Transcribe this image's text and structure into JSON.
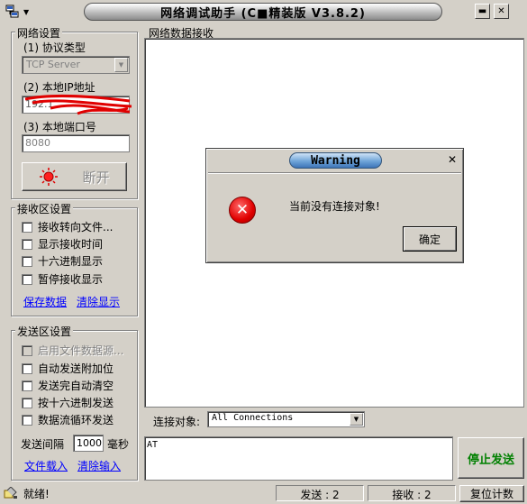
{
  "window": {
    "title": "网络调试助手 (C■精装版 V3.8.2)",
    "min_glyph": "▬",
    "close_glyph": "✕",
    "menu_arrow": "▼"
  },
  "net_settings": {
    "title": "网络设置",
    "protocol_label": "(1) 协议类型",
    "protocol_value": "TCP Server",
    "ip_label": "(2) 本地IP地址",
    "ip_value": "192.1",
    "port_label": "(3) 本地端口号",
    "port_value": "8080",
    "disconnect_label": "断开"
  },
  "recv_settings": {
    "title": "接收区设置",
    "options": [
      "接收转向文件...",
      "显示接收时间",
      "十六进制显示",
      "暂停接收显示"
    ],
    "save_link": "保存数据",
    "clear_link": "清除显示"
  },
  "send_settings": {
    "title": "发送区设置",
    "options": [
      "启用文件数据源...",
      "自动发送附加位",
      "发送完自动清空",
      "按十六进制发送",
      "数据流循环发送"
    ],
    "interval_label": "发送间隔",
    "interval_value": "1000",
    "interval_unit": "毫秒",
    "load_link": "文件载入",
    "clear_link": "清除输入"
  },
  "recv_area": {
    "title": "网络数据接收"
  },
  "connection": {
    "label": "连接对象:",
    "value": "All Connections"
  },
  "send_area": {
    "text": "AT",
    "stop_button": "停止发送"
  },
  "dialog": {
    "title": "Warning",
    "message": "当前没有连接对象!",
    "ok_label": "确定",
    "close_glyph": "✕",
    "icon_glyph": "✕"
  },
  "statusbar": {
    "status": "就绪!",
    "sent": "发送 : 2",
    "received": "接收 : 2",
    "reset": "复位计数"
  },
  "colors": {
    "face": "#d4d0c8",
    "stop_button_text": "#008000",
    "error_icon": "#e00000",
    "link": "#0000ff"
  }
}
